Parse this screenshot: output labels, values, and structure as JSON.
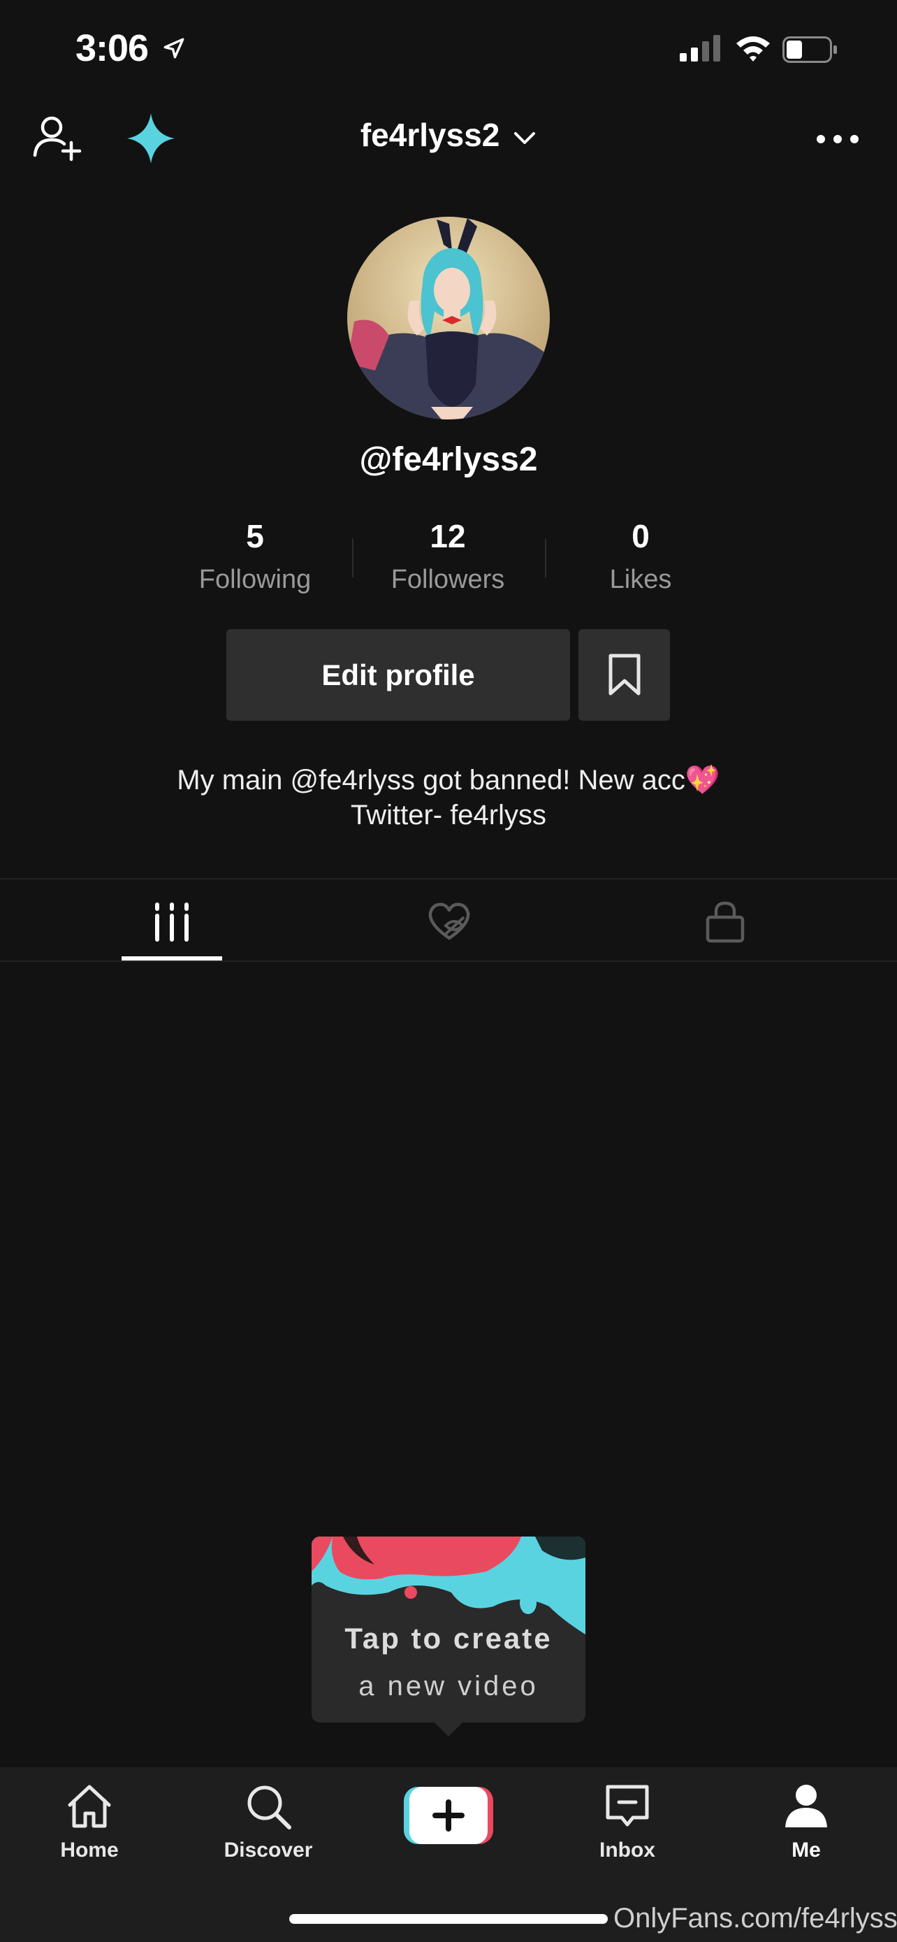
{
  "status_bar": {
    "time": "3:06"
  },
  "header": {
    "username": "fe4rlyss2"
  },
  "profile": {
    "handle": "@fe4rlyss2",
    "stats": [
      {
        "value": "5",
        "label": "Following"
      },
      {
        "value": "12",
        "label": "Followers"
      },
      {
        "value": "0",
        "label": "Likes"
      }
    ],
    "edit_label": "Edit profile",
    "bio_line1": "My main @fe4rlyss got banned! New acc💖",
    "bio_line2": "Twitter- fe4rlyss"
  },
  "tooltip": {
    "line1": "Tap to create",
    "line2": "a new video"
  },
  "nav": {
    "home": "Home",
    "discover": "Discover",
    "inbox": "Inbox",
    "me": "Me"
  },
  "watermark": "OnlyFans.com/fe4rlyss",
  "colors": {
    "background": "#121212",
    "accent_cyan": "#5ad3e1",
    "accent_red": "#ea4a5f",
    "button": "#2f2f2f"
  }
}
